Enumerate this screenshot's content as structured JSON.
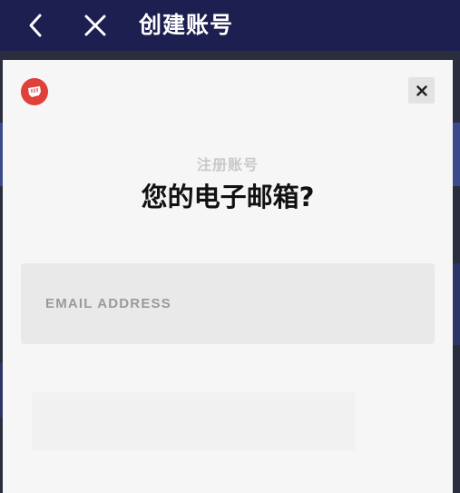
{
  "topbar": {
    "back_icon": "chevron-left-icon",
    "close_icon": "close-icon",
    "title": "创建账号",
    "background": "#1c1f4f"
  },
  "sheet": {
    "logo_icon": "riot-fist-logo-icon",
    "logo_color": "#e0403a",
    "close_icon": "close-icon",
    "subtitle": "注册账号",
    "heading": "您的电子邮箱?",
    "email": {
      "placeholder": "EMAIL ADDRESS",
      "value": ""
    }
  }
}
